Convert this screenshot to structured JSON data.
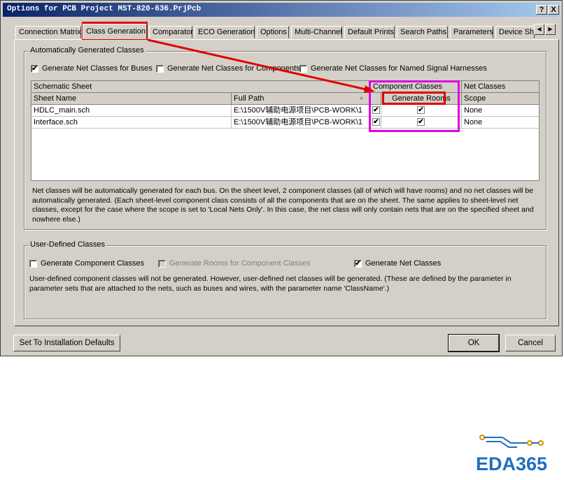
{
  "window": {
    "title": "Options for PCB Project MST-820-636.PrjPcb",
    "help_label": "?",
    "close_label": "X"
  },
  "tabs": [
    "Connection Matrix",
    "Class Generation",
    "Comparator",
    "ECO Generation",
    "Options",
    "Multi-Channel",
    "Default Prints",
    "Search Paths",
    "Parameters",
    "Device Sh"
  ],
  "tab_scroll": {
    "left": "◀",
    "right": "▶"
  },
  "auto_group": {
    "label": "Automatically Generated Classes",
    "cb_buses": {
      "label": "Generate Net Classes for Buses",
      "checked": "✔"
    },
    "cb_components": {
      "label": "Generate Net Classes for Components"
    },
    "cb_harnesses": {
      "label": "Generate Net Classes for Named Signal Harnesses"
    },
    "grid": {
      "h_schematic": "Schematic Sheet",
      "h_component_classes": "Component Classes",
      "h_net_classes": "Net Classes",
      "h_sheet_name": "Sheet Name",
      "h_full_path": "Full Path",
      "h_sort": "▲",
      "h_generate_rooms": "Generate Rooms",
      "h_scope": "Scope",
      "rows": [
        {
          "sheet": "HDLC_main.sch",
          "path": "E:\\1500V辅助电源项目\\PCB-WORK\\1",
          "cc": "✔",
          "rooms": "✔",
          "scope": "None"
        },
        {
          "sheet": "Interface.sch",
          "path": "E:\\1500V辅助电源项目\\PCB-WORK\\1",
          "cc": "✔",
          "rooms": "✔",
          "scope": "None"
        }
      ]
    },
    "description": "Net classes will be automatically generated for each bus. On the sheet level, 2 component classes (all of which will have rooms) and no net classes will be automatically generated. (Each sheet-level component class consists of all the components that are on the sheet. The same applies to sheet-level net classes, except for the case where the scope is set to 'Local Nets Only'. In this case, the net class will only contain nets that are on the specified sheet and nowhere else.)"
  },
  "user_group": {
    "label": "User-Defined Classes",
    "cb_component": {
      "label": "Generate Component Classes"
    },
    "cb_rooms": {
      "label": "Generate Rooms for Component Classes"
    },
    "cb_net": {
      "label": "Generate Net Classes",
      "checked": "✔"
    },
    "description": "User-defined component classes will not be generated. However, user-defined net classes will be generated. (These are defined by the parameter in parameter sets that are attached to the nets, such as buses and wires, with the parameter name 'ClassName'.)"
  },
  "buttons": {
    "defaults": "Set To Installation Defaults",
    "ok": "OK",
    "cancel": "Cancel"
  },
  "logo": {
    "text": "EDA365"
  },
  "colors": {
    "highlight_red": "#e00000",
    "highlight_magenta": "#e000e0",
    "logo_blue": "#1f6fbf"
  }
}
